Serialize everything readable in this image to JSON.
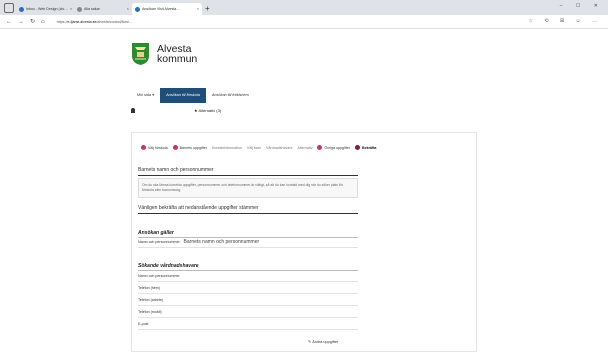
{
  "browser": {
    "tabs": [
      {
        "label": "Inbox - Web Design (clo…",
        "active": false
      },
      {
        "label": "Alla sakar",
        "active": false
      },
      {
        "label": "Ansökan Visit Alvesta…",
        "active": true
      }
    ],
    "url_prefix": "https://",
    "url_host": "e-tjanst.alvesta.se",
    "url_path": "/alvesta/control/flow/…"
  },
  "site": {
    "logo_line1": "Alvesta",
    "logo_line2": "kommun"
  },
  "menu": {
    "items": [
      {
        "label": "Min sida ▾",
        "active": false
      },
      {
        "label": "Ansökan till förskola",
        "active": true
      },
      {
        "label": "Ansökan till fritidshem",
        "active": false
      }
    ]
  },
  "subrow": {
    "star_label": "★  Alternativ (3)"
  },
  "steps": [
    {
      "label": "Välj förskola",
      "state": "done"
    },
    {
      "label": "Barnets uppgifter",
      "state": "done"
    },
    {
      "label": "Kontaktinformation",
      "state": "todo"
    },
    {
      "label": "Välj barn",
      "state": "todo"
    },
    {
      "label": "Vårdnadshavare",
      "state": "todo"
    },
    {
      "label": "Alternativ",
      "state": "todo"
    },
    {
      "label": "Övriga uppgifter",
      "state": "done"
    },
    {
      "label": "Bekräfta",
      "state": "current"
    }
  ],
  "form": {
    "section_title": "Barnets namn och personnummer",
    "info_text": "Om du ska lämna korrekta uppgifter, personnummer och telefonnummer är viktigt, så att du kan kontakt med dig när du söker plats för förskola eller barnomsorg.",
    "confirm_heading": "Vänligen bekräfta att nedanstående uppgifter stämmer",
    "applies_heading": "Ansökan gäller",
    "applies_row_label": "Namn och personnummer:",
    "applies_row_value": "Barnets namn och personnummer",
    "guardian_heading": "Sökande vårdnadshavare",
    "guardian_rows": [
      "Namn och personnummer",
      "Telefon (hem)",
      "Telefon (arbete)",
      "Telefon (mobil)",
      "E-post"
    ],
    "edit_label": "✎ Ändra uppgifter"
  }
}
